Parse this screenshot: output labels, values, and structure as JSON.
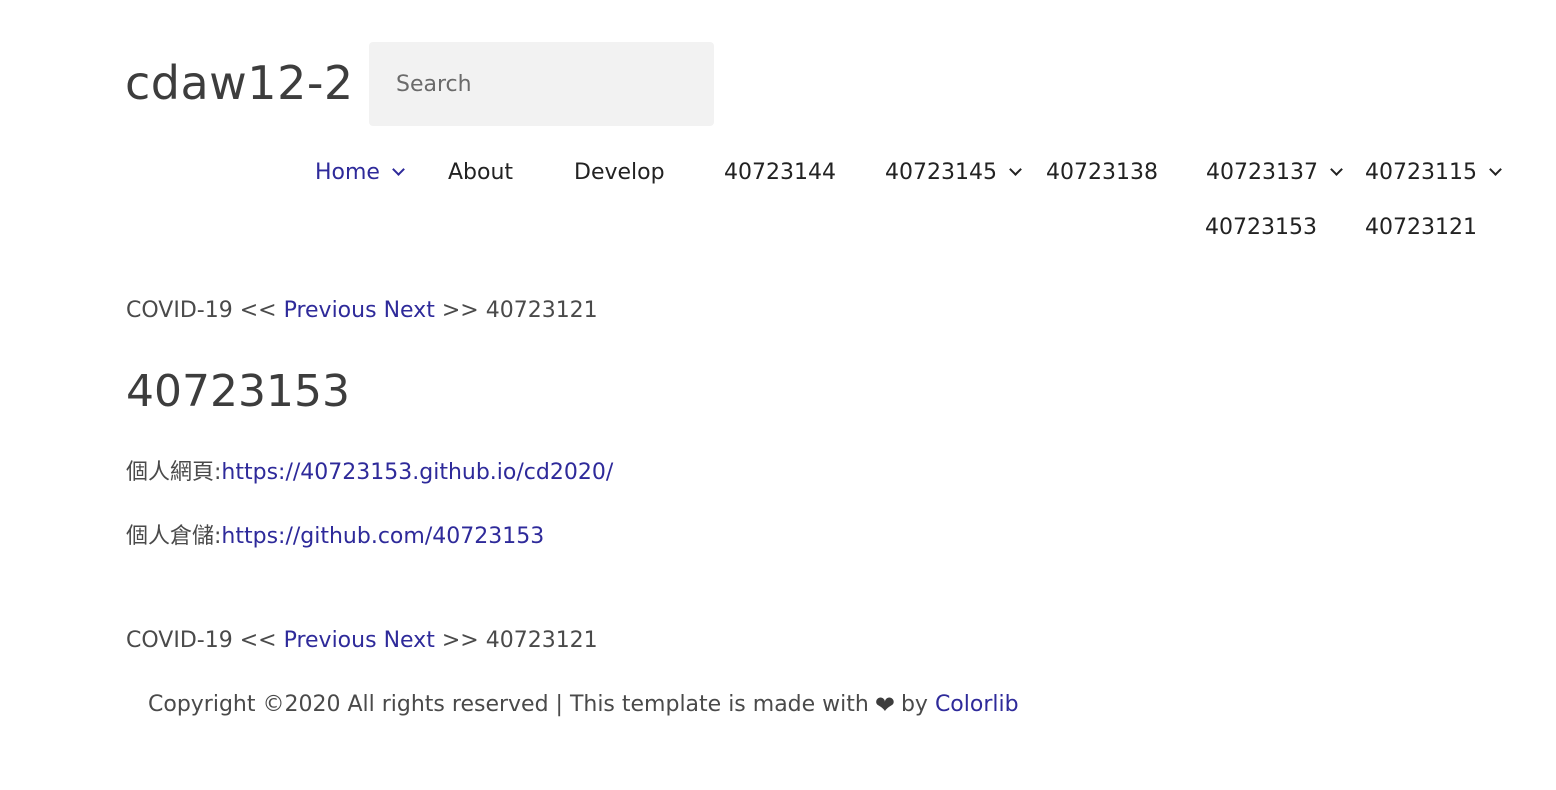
{
  "site": {
    "title": "cdaw12-2"
  },
  "search": {
    "placeholder": "Search"
  },
  "nav": {
    "items": [
      {
        "label": "Home",
        "has_dropdown": true,
        "active": true
      },
      {
        "label": "About",
        "has_dropdown": false
      },
      {
        "label": "Develop",
        "has_dropdown": false
      },
      {
        "label": "40723144",
        "has_dropdown": false
      },
      {
        "label": "40723145",
        "has_dropdown": true
      },
      {
        "label": "40723138",
        "has_dropdown": false
      },
      {
        "label": "40723137",
        "has_dropdown": true
      },
      {
        "label": "40723115",
        "has_dropdown": true
      },
      {
        "label": "40723153",
        "has_dropdown": false
      },
      {
        "label": "40723121",
        "has_dropdown": false
      }
    ]
  },
  "post_nav": {
    "prev_title": "COVID-19",
    "prev_arrows": "<<",
    "prev_label": "Previous",
    "next_label": "Next",
    "next_arrows": ">>",
    "next_title": "40723121"
  },
  "post": {
    "title": "40723153",
    "lines": [
      {
        "label": "個人網頁:",
        "link": "https://40723153.github.io/cd2020/"
      },
      {
        "label": "個人倉儲:",
        "link": "https://github.com/40723153"
      }
    ]
  },
  "footer": {
    "text_before": "Copyright ©2020 All rights reserved | This template is made with",
    "heart": "❤",
    "text_by": "by",
    "link": "Colorlib"
  },
  "colors": {
    "link": "#2e2a9a",
    "text": "#4a4a4a",
    "search_bg": "#f2f2f2"
  }
}
